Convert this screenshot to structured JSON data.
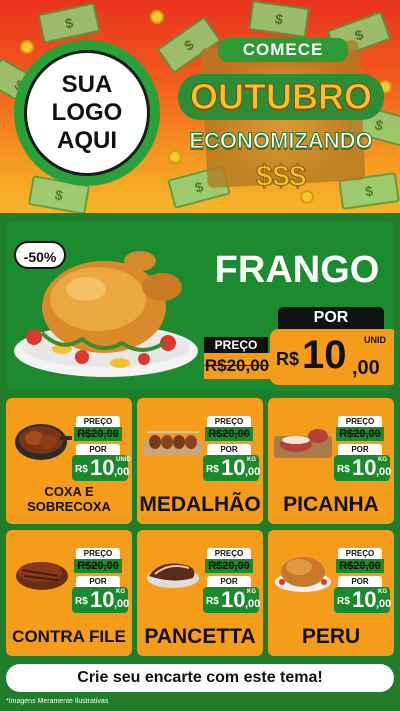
{
  "header": {
    "logo_lines": [
      "SUA",
      "LOGO",
      "AQUI"
    ],
    "badge": {
      "line1": "COMECE",
      "line2": "OUTUBRO",
      "line3": "ECONOMIZANDO",
      "line4": "$$$"
    }
  },
  "featured": {
    "discount": "-50%",
    "name": "FRANGO",
    "old_label": "PREÇO",
    "old_price": "R$20,00",
    "new_label": "POR",
    "currency": "R$",
    "price_int": "10",
    "price_dec": ",00",
    "unit": "UNID"
  },
  "products": [
    {
      "name": "COXA E SOBRECOXA",
      "old_label": "PREÇO",
      "old_price": "R$20,00",
      "new_label": "POR",
      "currency": "R$",
      "price_int": "10",
      "price_dec": ",00",
      "unit": "UNID"
    },
    {
      "name": "MEDALHÃO",
      "old_label": "PREÇO",
      "old_price": "R$20,00",
      "new_label": "POR",
      "currency": "R$",
      "price_int": "10",
      "price_dec": ",00",
      "unit": "KG"
    },
    {
      "name": "PICANHA",
      "old_label": "PREÇO",
      "old_price": "R$20,00",
      "new_label": "POR",
      "currency": "R$",
      "price_int": "10",
      "price_dec": ",00",
      "unit": "KG"
    },
    {
      "name": "CONTRA FILE",
      "old_label": "PREÇO",
      "old_price": "R$20,00",
      "new_label": "POR",
      "currency": "R$",
      "price_int": "10",
      "price_dec": ",00",
      "unit": "KG"
    },
    {
      "name": "PANCETTA",
      "old_label": "PREÇO",
      "old_price": "R$20,00",
      "new_label": "POR",
      "currency": "R$",
      "price_int": "10",
      "price_dec": ",00",
      "unit": "KG"
    },
    {
      "name": "PERU",
      "old_label": "PREÇO",
      "old_price": "R$20,00",
      "new_label": "POR",
      "currency": "R$",
      "price_int": "10",
      "price_dec": ",00",
      "unit": "KG"
    }
  ],
  "cta": "Crie seu encarte com este tema!",
  "disclaimer": "*Imagens Meramente Ilustrativas",
  "colors": {
    "header_red": "#e8331d",
    "header_orange": "#f59a21",
    "green": "#1f7d2c",
    "price_orange": "#f59c1a"
  }
}
